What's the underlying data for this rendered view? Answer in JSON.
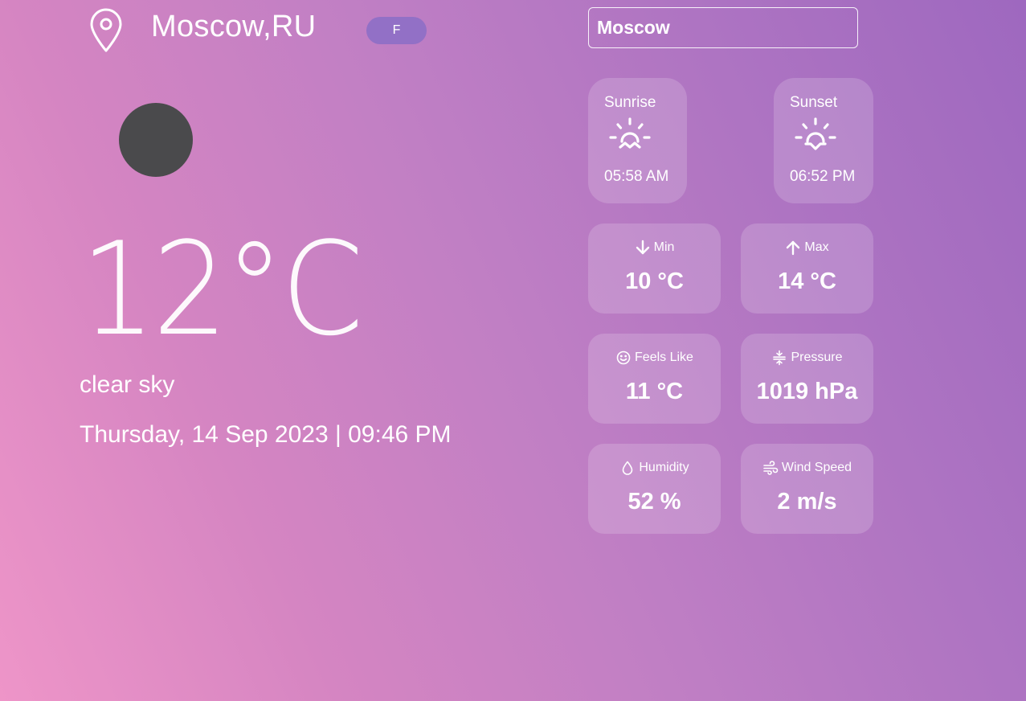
{
  "header": {
    "location_icon": "map-pin-icon",
    "city": "Moscow,RU",
    "unit_toggle_label": "F"
  },
  "search": {
    "value": "Moscow"
  },
  "current": {
    "weather_icon": "weather-icon",
    "temperature": "12°C",
    "description": "clear sky",
    "datetime": "Thursday, 14 Sep 2023 | 09:46 PM"
  },
  "sun": {
    "sunrise_label": "Sunrise",
    "sunrise_time": "05:58 AM",
    "sunrise_icon": "sunrise-icon",
    "sunset_label": "Sunset",
    "sunset_time": "06:52 PM",
    "sunset_icon": "sunset-icon"
  },
  "stats": {
    "min_label": "Min",
    "min_value": "10 °C",
    "min_icon": "arrow-down-icon",
    "max_label": "Max",
    "max_value": "14 °C",
    "max_icon": "arrow-up-icon",
    "feels_label": "Feels Like",
    "feels_value": "11 °C",
    "feels_icon": "smiley-icon",
    "pressure_label": "Pressure",
    "pressure_value": "1019 hPa",
    "pressure_icon": "compress-icon",
    "humidity_label": "Humidity",
    "humidity_value": "52 %",
    "humidity_icon": "water-drop-icon",
    "wind_label": "Wind Speed",
    "wind_value": "2 m/s",
    "wind_icon": "wind-icon"
  },
  "colors": {
    "gradient_start": "#ee95c8",
    "gradient_end": "#9e68bf",
    "toggle_bg": "#9270c6",
    "weather_icon_fill": "#4a4a4c"
  }
}
